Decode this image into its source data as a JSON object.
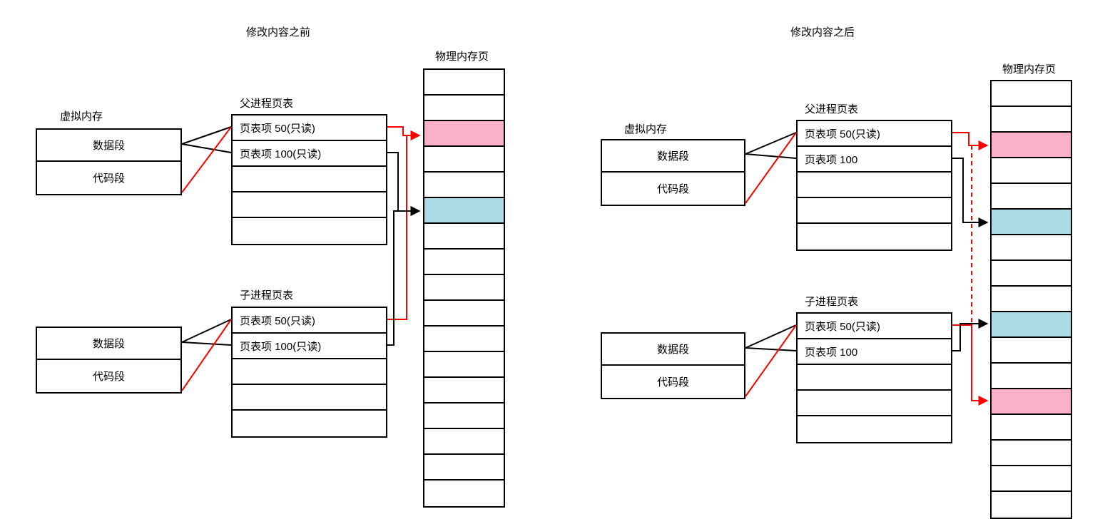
{
  "left": {
    "title": "修改内容之前",
    "virtual_mem_label": "虚拟内存",
    "virtual_mem": [
      "数据段",
      "代码段"
    ],
    "parent_table_label": "父进程页表",
    "parent_table": [
      "页表项 50(只读)",
      "页表项 100(只读)",
      "",
      "",
      ""
    ],
    "child_table_label": "子进程页表",
    "child_table": [
      "页表项 50(只读)",
      "页表项 100(只读)",
      "",
      "",
      ""
    ],
    "phys_label": "物理内存页",
    "phys_colors": [
      "",
      "",
      "pink",
      "",
      "",
      "blue",
      "",
      "",
      "",
      "",
      "",
      "",
      "",
      "",
      "",
      "",
      ""
    ]
  },
  "right": {
    "title": "修改内容之后",
    "virtual_mem_label": "虚拟内存",
    "virtual_mem": [
      "数据段",
      "代码段"
    ],
    "parent_table_label": "父进程页表",
    "parent_table": [
      "页表项 50(只读)",
      "页表项 100",
      "",
      "",
      ""
    ],
    "child_table_label": "子进程页表",
    "child_table": [
      "页表项 50(只读)",
      "页表项 100",
      "",
      "",
      ""
    ],
    "phys_label": "物理内存页",
    "phys_colors": [
      "",
      "",
      "pink",
      "",
      "",
      "blue",
      "",
      "",
      "",
      "blue",
      "",
      "",
      "pink",
      "",
      "",
      "",
      ""
    ]
  }
}
